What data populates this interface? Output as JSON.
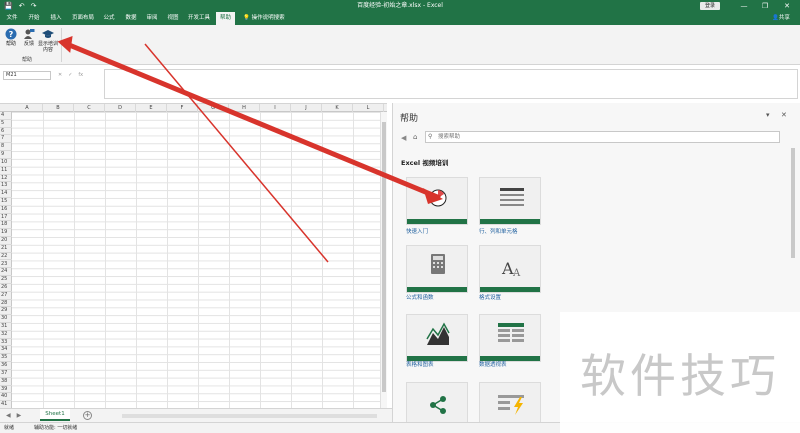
{
  "titlebar": {
    "title": "百度经验-初始之章.xlsx  -  Excel",
    "login": "登录",
    "save_glyph": "💾",
    "undo_glyph": "↶",
    "redo_glyph": "↷",
    "minimize_glyph": "—",
    "restore_glyph": "❐",
    "close_glyph": "✕"
  },
  "tabs": [
    "文件",
    "开始",
    "插入",
    "页面布局",
    "公式",
    "数据",
    "审阅",
    "视图",
    "开发工具",
    "帮助"
  ],
  "active_tab": "帮助",
  "tellme": "操作说明搜索",
  "share": "共享",
  "ribbon": {
    "help_label": "帮助",
    "feedback_label": "反馈",
    "training_label": "显示培训内容",
    "group_label": "帮助"
  },
  "namebox": "M21",
  "fx": {
    "cancel": "✕",
    "confirm": "✓",
    "fx": "fx"
  },
  "columns": [
    "A",
    "B",
    "C",
    "D",
    "E",
    "F",
    "G",
    "H",
    "I",
    "J",
    "K",
    "L"
  ],
  "rows": [
    "4",
    "5",
    "6",
    "7",
    "8",
    "9",
    "10",
    "11",
    "12",
    "13",
    "14",
    "15",
    "16",
    "17",
    "18",
    "19",
    "20",
    "21",
    "22",
    "23",
    "24",
    "25",
    "26",
    "27",
    "28",
    "29",
    "30",
    "31",
    "32",
    "33",
    "34",
    "35",
    "36",
    "37",
    "38",
    "39",
    "40",
    "41"
  ],
  "sheet_tab": "Sheet1",
  "status": {
    "ready": "就绪",
    "accessibility": "辅助功能: 一切就绪"
  },
  "help_pane": {
    "title": "帮助",
    "search_placeholder": "搜索帮助",
    "section": "Excel 视频培训",
    "cards": [
      {
        "label": "快速入门"
      },
      {
        "label": "行、列和单元格"
      },
      {
        "label": "公式和函数"
      },
      {
        "label": "格式设置"
      },
      {
        "label": "表格和图表"
      },
      {
        "label": "数据透视表"
      },
      {
        "label": ""
      },
      {
        "label": ""
      }
    ]
  },
  "watermark": "软件技巧"
}
